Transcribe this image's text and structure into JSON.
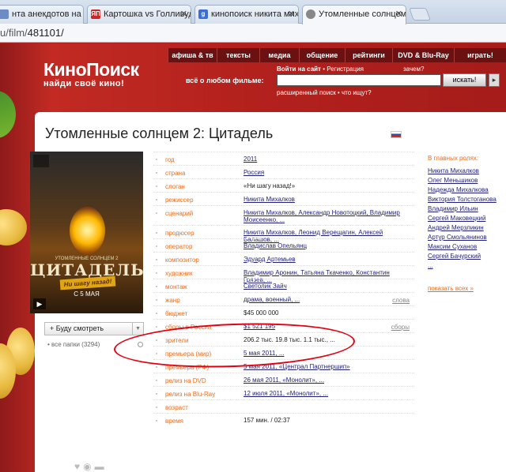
{
  "browser": {
    "tabs": [
      {
        "label": "нта анекдотов на втор",
        "favicon_color": "#6d8cc5"
      },
      {
        "label": "Картошка vs Голливуд - ",
        "favicon_text": "ЯП",
        "favicon_color": "#c62828"
      },
      {
        "label": "кинопоиск никита михал",
        "favicon_text": "g",
        "favicon_color": "#3b6fd6"
      },
      {
        "label": "Утомленные солнцем 2: ",
        "favicon_color": "#888888"
      }
    ],
    "url_prefix": "u/film/",
    "url_path": "481101/"
  },
  "header": {
    "logo_main": "КиноПоиск",
    "logo_tagline": "найди своё кино!",
    "nav": [
      "афиша & тв",
      "тексты",
      "медиа",
      "общение",
      "рейтинги",
      "DVD & Blu-Ray",
      "играть!"
    ],
    "search_label": "всё о любом фильме:",
    "login_text": "Войти на сайт",
    "register_text": "Регистрация",
    "why_text": "зачем?",
    "search_button": "искать!",
    "search_go": "▸",
    "advanced_text": "расширенный поиск • что ищут?"
  },
  "film": {
    "title": "Утомленные солнцем 2: Цитадель",
    "poster_small_text": "УТОМЛЕННЫЕ СОЛНЦЕМ 2",
    "poster_title": "ЦИТАДЕЛЬ",
    "poster_tagline": "Ни шагу назад!",
    "poster_date": "С 5 МАЯ",
    "watch_button": "Буду смотреть",
    "folders_text": "все папки (3294)"
  },
  "info_rows": [
    {
      "label": "год",
      "value": "2011",
      "link": true
    },
    {
      "label": "страна",
      "value": "Россия",
      "link": true
    },
    {
      "label": "слоган",
      "value": "«Ни шагу назад!»",
      "link": false
    },
    {
      "label": "режиссер",
      "value": "Никита Михалков",
      "link": true
    },
    {
      "label": "сценарий",
      "value": "Никита Михалков, Александр Новотоцкий, Владимир Моисеенко, ...",
      "link": true
    },
    {
      "label": "продюсер",
      "value": "Никита Михалков, Леонид Верещагин, Алексей Балашов, ...",
      "link": true
    },
    {
      "label": "оператор",
      "value": "Владислав Опельянц",
      "link": true
    },
    {
      "label": "композитор",
      "value": "Эдуард Артемьев",
      "link": true
    },
    {
      "label": "художник",
      "value": "Владимир Аронин, Татьяна Ткаченко, Константин Грязев, ...",
      "link": true
    },
    {
      "label": "монтаж",
      "value": "Светолик Зайч",
      "link": true
    },
    {
      "label": "жанр",
      "value": "драма, военный, ...",
      "link": true,
      "extra": "слова"
    },
    {
      "label": "бюджет",
      "value": "$45 000 000",
      "link": false
    },
    {
      "label": "сборы в России",
      "value": "$1 521 195",
      "link": true,
      "extra": "сборы"
    },
    {
      "label": "зрители",
      "value": "206.2 тыс.    19.8 тыс.    1.1 тыс., ...",
      "link": false
    },
    {
      "label": "премьера (мир)",
      "value": "5 мая 2011, ...",
      "link": true
    },
    {
      "label": "премьера (РФ)",
      "value": "5 мая 2011, «Централ Партнершип»",
      "link": true
    },
    {
      "label": "релиз на DVD",
      "value": "26 мая 2011, «Монолит», ...",
      "link": true
    },
    {
      "label": "релиз на Blu-Ray",
      "value": "12 июля 2011, «Монолит», ...",
      "link": true
    },
    {
      "label": "возраст",
      "value": "",
      "link": false
    },
    {
      "label": "время",
      "value": "157 мин. / 02:37",
      "link": false
    }
  ],
  "roles": {
    "heading": "В главных ролях:",
    "actors": [
      "Никита Михалков",
      "Олег Меньшиков",
      "Надежда Михалкова",
      "Виктория Толстоганова",
      "Владимир Ильин",
      "Сергей Маковецкий",
      "Андрей Мерзликин",
      "Артур Смольянинов",
      "Максим Суханов",
      "Сергей Бачурский",
      "..."
    ],
    "more": "показать всех »"
  },
  "colors": {
    "brand_red": "#b31f1f",
    "label_orange": "#f06c1a",
    "link_blue": "#1f1f7a",
    "annotation_red": "#e30010"
  }
}
